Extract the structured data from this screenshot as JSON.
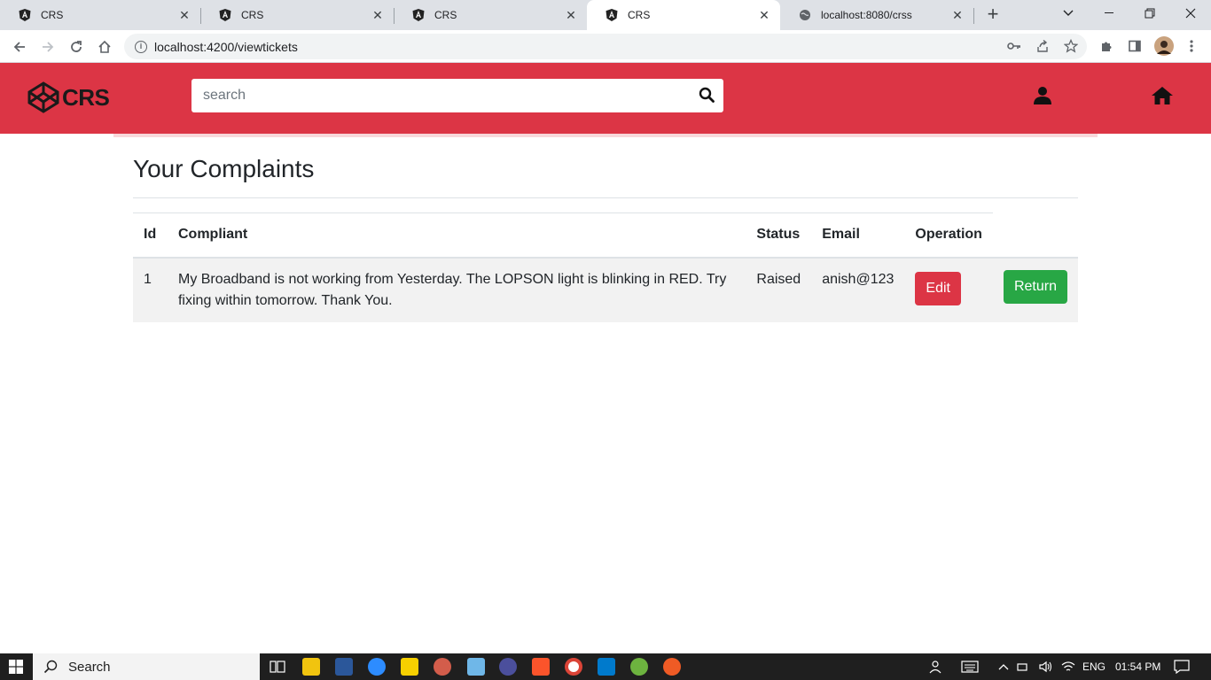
{
  "browser": {
    "tabs": [
      {
        "title": "CRS",
        "active": false
      },
      {
        "title": "CRS",
        "active": false
      },
      {
        "title": "CRS",
        "active": false
      },
      {
        "title": "CRS",
        "active": true
      },
      {
        "title": "localhost:8080/crss",
        "active": false
      }
    ],
    "url": "localhost:4200/viewtickets"
  },
  "header": {
    "brand": "CRS",
    "search_placeholder": "search",
    "colors": {
      "header_bg": "#dc3545",
      "edit_btn": "#dc3545",
      "return_btn": "#28a745"
    }
  },
  "page": {
    "title": "Your Complaints"
  },
  "table": {
    "columns": [
      "Id",
      "Compliant",
      "Status",
      "Email",
      "Operation"
    ],
    "rows": [
      {
        "id": "1",
        "complaint": "My Broadband is not working from Yesterday. The LOPSON light is blinking in RED. Try fixing within tomorrow. Thank You.",
        "status": "Raised",
        "email": "anish@123",
        "edit_label": "Edit",
        "return_label": "Return"
      }
    ]
  },
  "taskbar": {
    "search_label": "Search",
    "language": "ENG",
    "time": "01:54 PM"
  }
}
